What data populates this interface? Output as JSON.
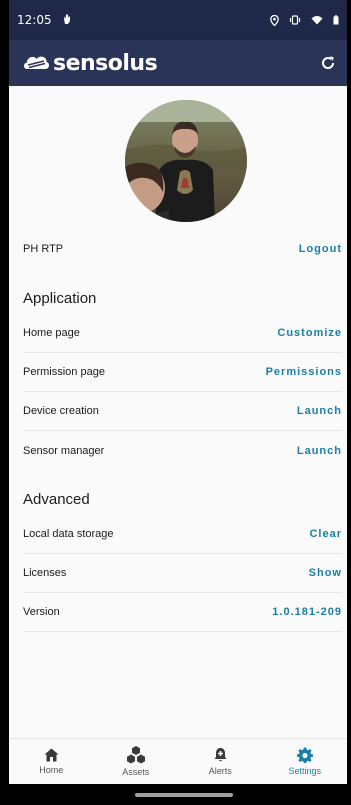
{
  "status_bar": {
    "time": "12:05"
  },
  "app_bar": {
    "logo_text": "sensolus"
  },
  "profile": {
    "user_name": "PH RTP",
    "logout_label": "Logout"
  },
  "application": {
    "title": "Application",
    "rows": [
      {
        "label": "Home page",
        "action": "Customize"
      },
      {
        "label": "Permission page",
        "action": "Permissions"
      },
      {
        "label": "Device creation",
        "action": "Launch"
      },
      {
        "label": "Sensor manager",
        "action": "Launch"
      }
    ]
  },
  "advanced": {
    "title": "Advanced",
    "rows": [
      {
        "label": "Local data storage",
        "action": "Clear"
      },
      {
        "label": "Licenses",
        "action": "Show"
      },
      {
        "label": "Version",
        "action": "1.0.181-209"
      }
    ]
  },
  "bottom_nav": {
    "items": [
      {
        "label": "Home",
        "icon": "home-icon"
      },
      {
        "label": "Assets",
        "icon": "hexagons-icon"
      },
      {
        "label": "Alerts",
        "icon": "bell-icon"
      },
      {
        "label": "Settings",
        "icon": "gear-icon"
      }
    ],
    "active": "Settings"
  },
  "colors": {
    "status_bar": "#20284a",
    "app_bar": "#2a3458",
    "accent": "#1a7fa6"
  }
}
